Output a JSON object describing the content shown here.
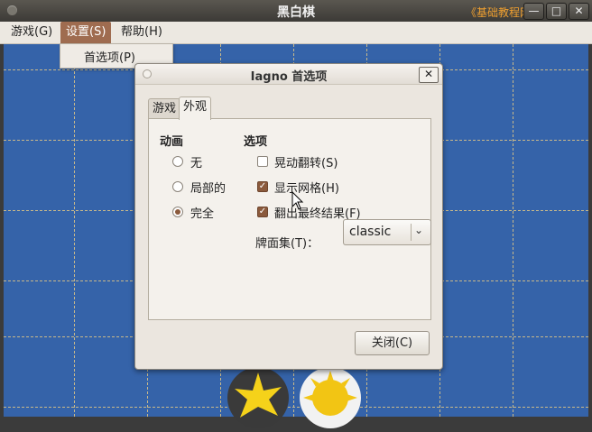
{
  "window": {
    "title": "黑白棋",
    "watermark": "《基础教程网》",
    "minimize_glyph": "—",
    "maximize_glyph": "□",
    "close_glyph": "✕"
  },
  "menubar": {
    "items": [
      {
        "label": "游戏(G)"
      },
      {
        "label": "设置(S)"
      },
      {
        "label": "帮助(H)"
      }
    ],
    "dropdown": {
      "items": [
        {
          "label": "首选项(P)"
        }
      ]
    }
  },
  "dialog": {
    "title": "Iagno 首选项",
    "close_glyph": "✕",
    "tabs": [
      {
        "label": "游戏"
      },
      {
        "label": "外观"
      }
    ],
    "animation": {
      "header": "动画",
      "options": [
        {
          "label": "无",
          "selected": false
        },
        {
          "label": "局部的",
          "selected": false
        },
        {
          "label": "完全",
          "selected": true
        }
      ]
    },
    "options": {
      "header": "选项",
      "checkboxes": [
        {
          "label": "晃动翻转(S)",
          "checked": false
        },
        {
          "label": "显示网格(H)",
          "checked": true
        },
        {
          "label": "翻出最终结果(F)",
          "checked": true
        }
      ]
    },
    "tileset": {
      "label": "牌面集(T)：",
      "value": "classic",
      "arrow": "⌄"
    },
    "close_button": "关闭(C)"
  },
  "colors": {
    "board": "#3563a9",
    "accent": "#9f6c50",
    "dialog_bg": "#ebe6df"
  }
}
